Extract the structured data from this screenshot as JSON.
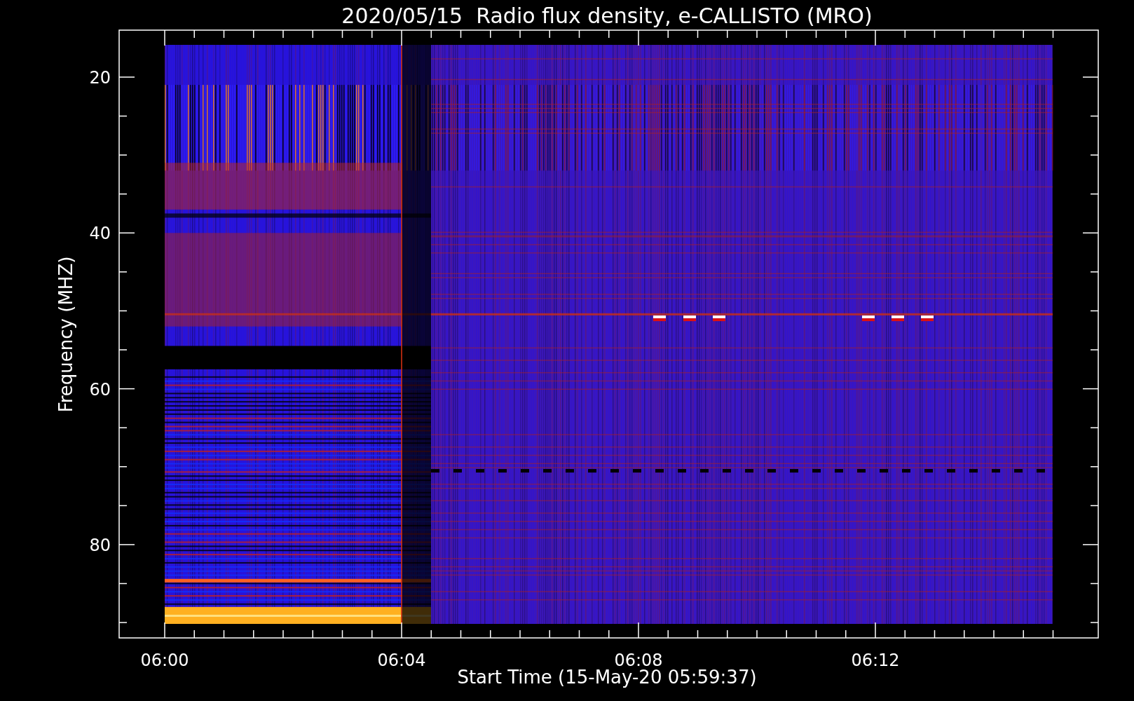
{
  "title": "2020/05/15  Radio flux density, e-CALLISTO (MRO)",
  "plot": {
    "ylabel": "Frequency (MHZ)",
    "xlabel": "Start Time (15-May-20 05:59:37)",
    "yticks": [
      "20",
      "40",
      "60",
      "80"
    ],
    "xticks": [
      "06:00",
      "06:04",
      "06:08",
      "06:12"
    ]
  }
}
